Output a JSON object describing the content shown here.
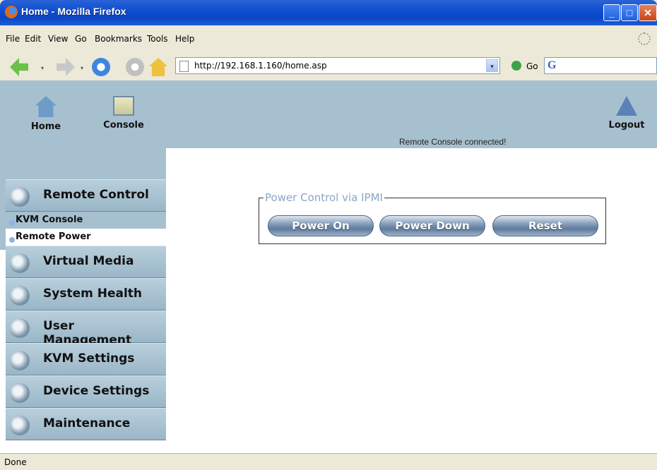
{
  "window": {
    "title": "Home - Mozilla Firefox",
    "min_glyph": "_",
    "max_glyph": "□",
    "close_glyph": "✕"
  },
  "menu": {
    "items": [
      "File",
      "Edit",
      "View",
      "Go",
      "Bookmarks",
      "Tools",
      "Help"
    ]
  },
  "toolbar": {
    "url": "http://192.168.1.160/home.asp",
    "go_label": "Go",
    "dropdown_glyph": "▾"
  },
  "header": {
    "home_label": "Home",
    "console_label": "Console",
    "logout_label": "Logout",
    "status_message": "Remote Console connected!"
  },
  "sidebar": {
    "sections": [
      {
        "label": "Remote Control",
        "icon": "monitor-icon"
      },
      {
        "label": "Virtual Media",
        "icon": "disc-icon"
      },
      {
        "label": "System Health",
        "icon": "health-icon"
      },
      {
        "label": "User Management",
        "icon": "users-icon"
      },
      {
        "label": "KVM Settings",
        "icon": "kvm-icon"
      },
      {
        "label": "Device Settings",
        "icon": "gears-icon"
      },
      {
        "label": "Maintenance",
        "icon": "tools-icon"
      }
    ],
    "sub_items": [
      {
        "label": "KVM Console"
      },
      {
        "label": "Remote Power"
      }
    ]
  },
  "power_control": {
    "legend": "Power Control via IPMI",
    "buttons": {
      "power_on": "Power On",
      "power_down": "Power Down",
      "reset": "Reset"
    }
  },
  "statusbar": {
    "text": "Done"
  }
}
